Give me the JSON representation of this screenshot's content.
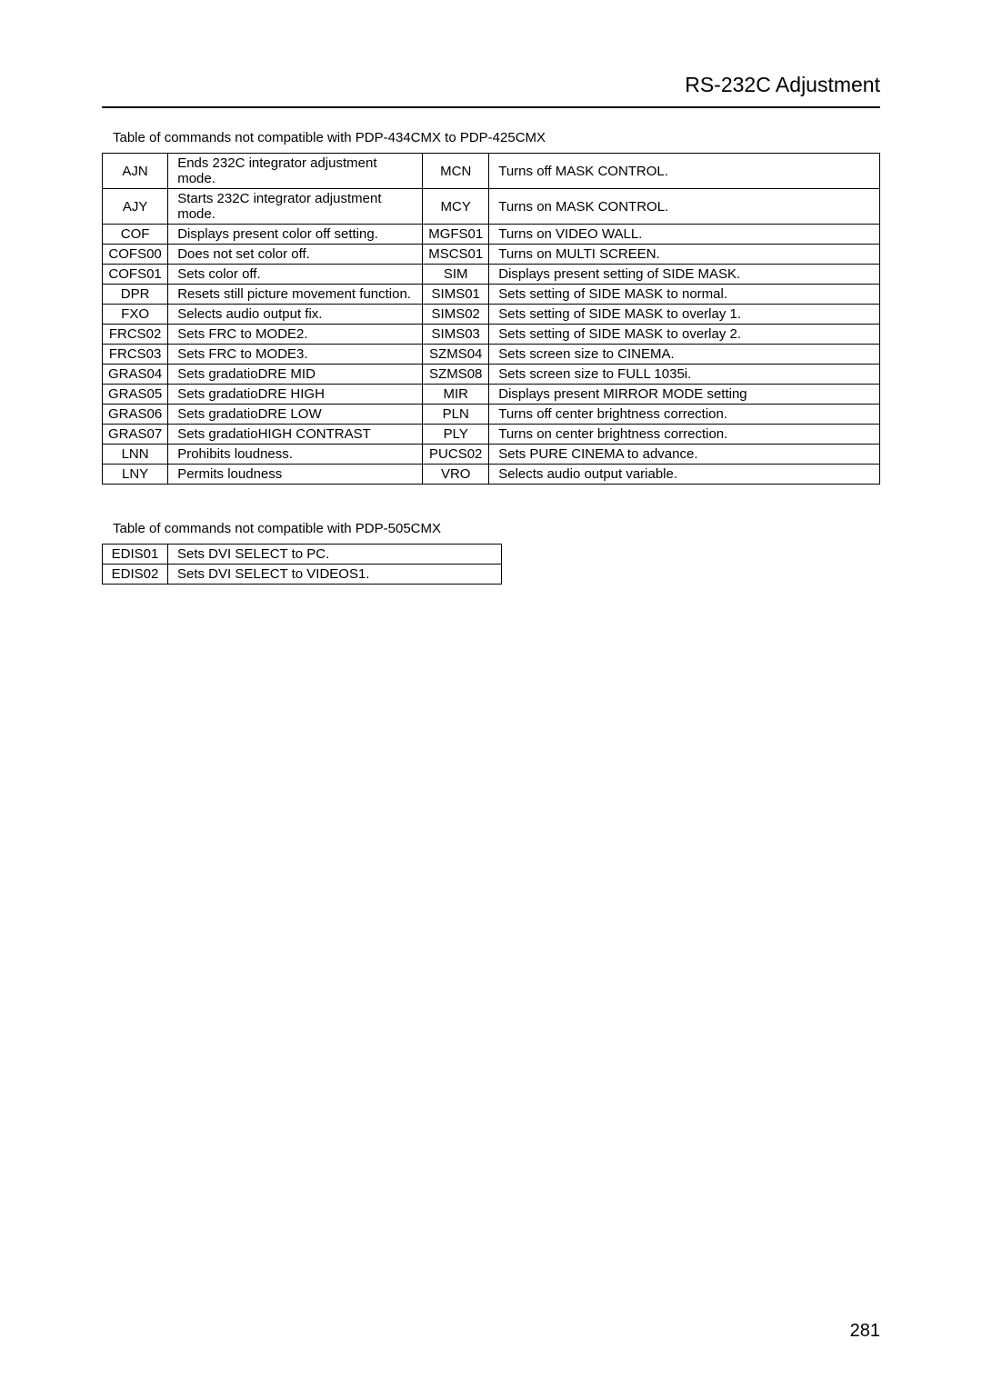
{
  "header": {
    "title": "RS-232C Adjustment"
  },
  "table1": {
    "caption": "Table of commands not compatible with PDP-434CMX to PDP-425CMX",
    "rows": [
      {
        "c1": "AJN",
        "d1": "Ends 232C integrator adjustment mode.",
        "c2": "MCN",
        "d2": "Turns off MASK CONTROL."
      },
      {
        "c1": "AJY",
        "d1": "Starts 232C integrator adjustment mode.",
        "c2": "MCY",
        "d2": "Turns on MASK CONTROL."
      },
      {
        "c1": "COF",
        "d1": "Displays present color off setting.",
        "c2": "MGFS01",
        "d2": "Turns on VIDEO WALL."
      },
      {
        "c1": "COFS00",
        "d1": "Does not set color off.",
        "c2": "MSCS01",
        "d2": "Turns on MULTI SCREEN."
      },
      {
        "c1": "COFS01",
        "d1": "Sets color off.",
        "c2": "SIM",
        "d2": "Displays present setting of SIDE MASK."
      },
      {
        "c1": "DPR",
        "d1": "Resets still picture movement function.",
        "c2": "SIMS01",
        "d2": "Sets setting of SIDE MASK to normal."
      },
      {
        "c1": "FXO",
        "d1": "Selects audio output fix.",
        "c2": "SIMS02",
        "d2": "Sets setting of SIDE MASK to overlay 1."
      },
      {
        "c1": "FRCS02",
        "d1": "Sets FRC to MODE2.",
        "c2": "SIMS03",
        "d2": "Sets setting of SIDE MASK to overlay 2."
      },
      {
        "c1": "FRCS03",
        "d1": "Sets FRC to MODE3.",
        "c2": "SZMS04",
        "d2": "Sets screen size to CINEMA."
      },
      {
        "c1": "GRAS04",
        "d1": "Sets gradatioDRE MID",
        "c2": "SZMS08",
        "d2": "Sets screen size to FULL 1035i."
      },
      {
        "c1": "GRAS05",
        "d1": "Sets gradatioDRE HIGH",
        "c2": "MIR",
        "d2": "Displays present MIRROR MODE setting"
      },
      {
        "c1": "GRAS06",
        "d1": "Sets gradatioDRE LOW",
        "c2": "PLN",
        "d2": "Turns off center brightness correction."
      },
      {
        "c1": "GRAS07",
        "d1": "Sets gradatioHIGH CONTRAST",
        "c2": "PLY",
        "d2": "Turns on center brightness correction."
      },
      {
        "c1": "LNN",
        "d1": "Prohibits loudness.",
        "c2": "PUCS02",
        "d2": "Sets PURE CINEMA to advance."
      },
      {
        "c1": "LNY",
        "d1": "Permits loudness",
        "c2": "VRO",
        "d2": "Selects audio output variable."
      }
    ]
  },
  "table2": {
    "caption": "Table of commands not compatible with PDP-505CMX",
    "rows": [
      {
        "c1": "EDIS01",
        "d1": "Sets DVI SELECT to PC."
      },
      {
        "c1": "EDIS02",
        "d1": "Sets DVI SELECT to VIDEOS1."
      }
    ]
  },
  "pageNumber": "281"
}
